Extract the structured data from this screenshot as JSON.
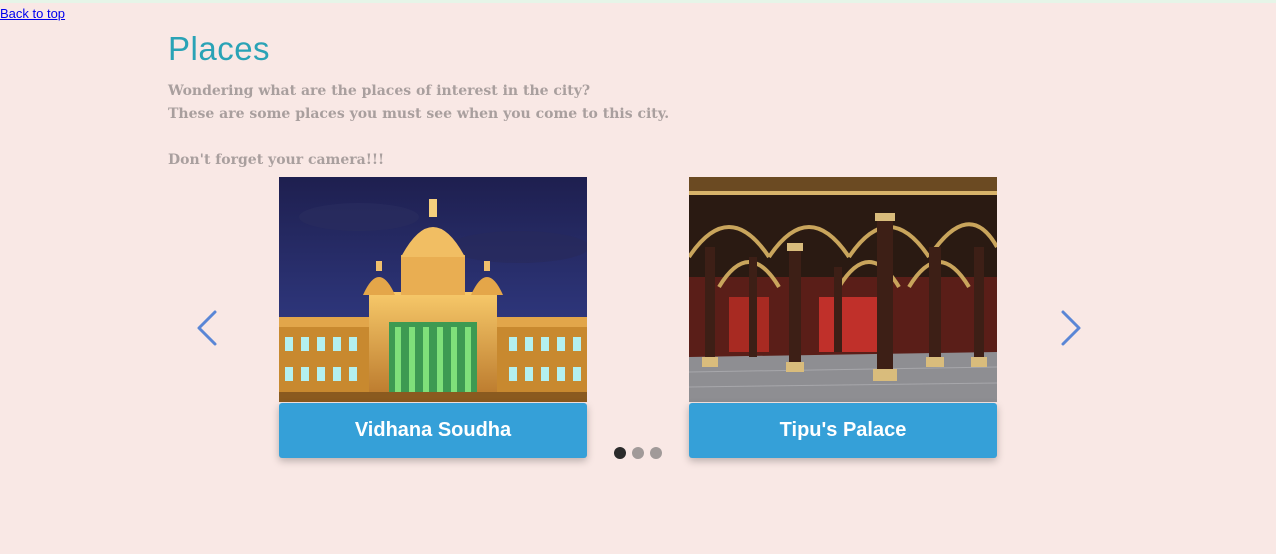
{
  "nav": {
    "back_to_top": "Back to top"
  },
  "section": {
    "title": "Places",
    "intro_lines": [
      "Wondering what are the places of interest in the city?",
      "These are some places you must see when you come to this city.",
      "Don't forget your camera!!!"
    ]
  },
  "carousel": {
    "cards": [
      {
        "title": "Vidhana Soudha",
        "image": "vidhana-soudha-photo"
      },
      {
        "title": "Tipu's Palace",
        "image": "tipus-palace-photo"
      }
    ],
    "dots_total": 3,
    "active_dot": 1,
    "colors": {
      "accent": "#35a0d8",
      "title": "#2aa3b6",
      "arrow": "#5a86d6",
      "background": "#f9e8e5"
    },
    "icons": {
      "prev": "chevron-left-icon",
      "next": "chevron-right-icon"
    }
  }
}
